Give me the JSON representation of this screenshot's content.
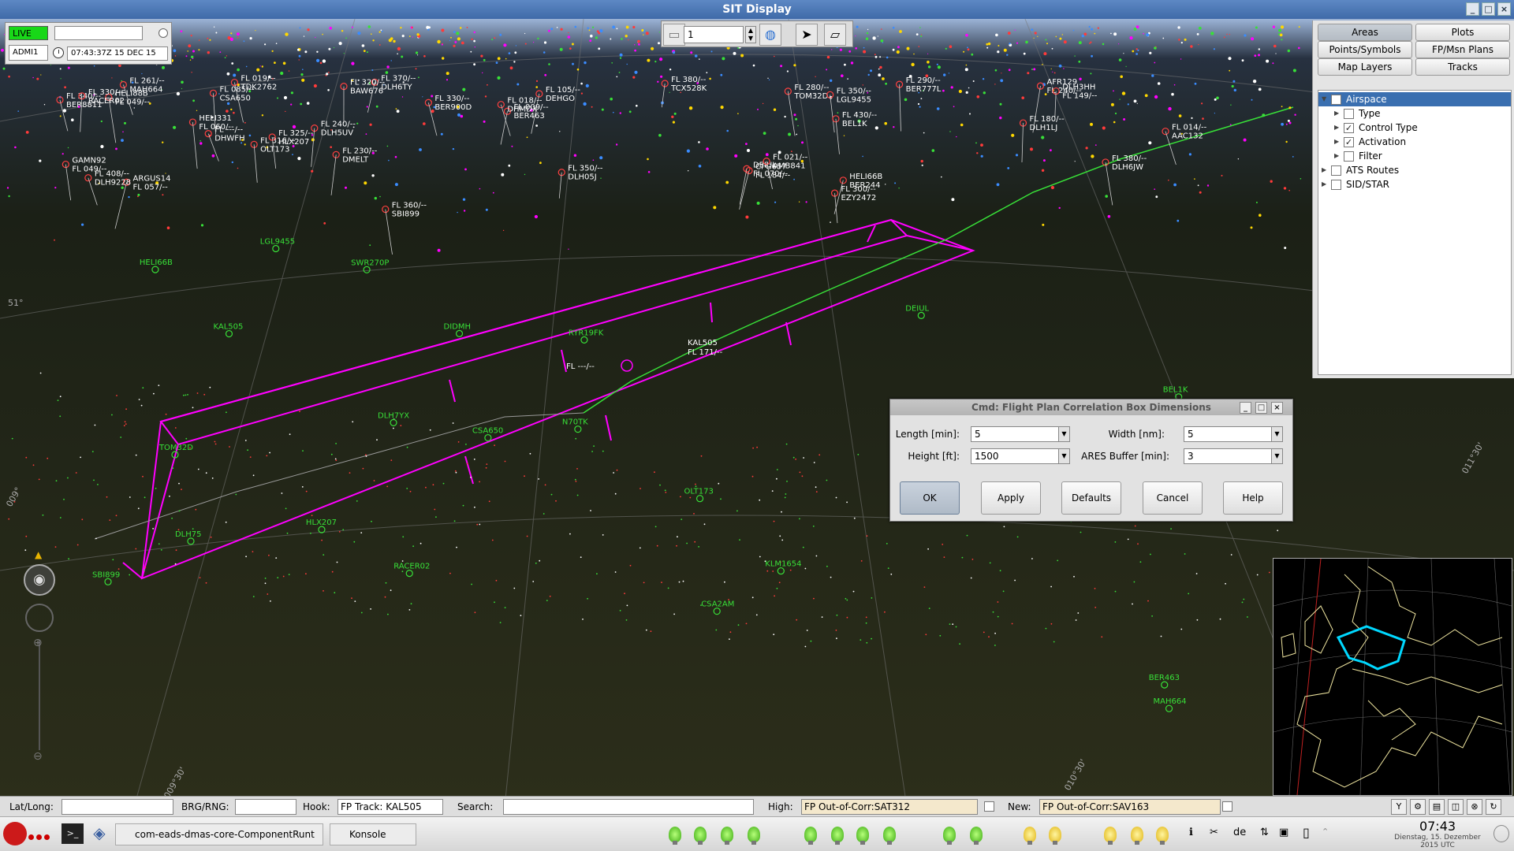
{
  "window": {
    "title": "SIT Display",
    "controls": [
      "_",
      "□",
      "×"
    ]
  },
  "status_panel": {
    "live_label": "LIVE",
    "live_value": "",
    "user": "ADMI1",
    "datetime": "07:43:37Z 15 DEC 15"
  },
  "toolbar": {
    "zoom_value": "1",
    "zoom_up": "▲",
    "zoom_down": "▼",
    "icons": [
      "layers-icon",
      "globe-icon",
      "pointer-icon",
      "ruler-icon"
    ]
  },
  "right_panel": {
    "buttons": [
      {
        "label": "Areas",
        "selected": true
      },
      {
        "label": "Plots",
        "selected": false
      },
      {
        "label": "Points/Symbols",
        "selected": false
      },
      {
        "label": "FP/Msn Plans",
        "selected": false
      },
      {
        "label": "Map Layers",
        "selected": false
      },
      {
        "label": "Tracks",
        "selected": false
      }
    ],
    "tree": [
      {
        "label": "Airspace",
        "level": 0,
        "checked": false,
        "expanded": true,
        "selected": true
      },
      {
        "label": "Type",
        "level": 1,
        "checked": false
      },
      {
        "label": "Control Type",
        "level": 1,
        "checked": true
      },
      {
        "label": "Activation",
        "level": 1,
        "checked": true
      },
      {
        "label": "Filter",
        "level": 1,
        "checked": false
      },
      {
        "label": "ATS Routes",
        "level": 0,
        "checked": false
      },
      {
        "label": "SID/STAR",
        "level": 0,
        "checked": false
      }
    ]
  },
  "dialog": {
    "title": "Cmd: Flight Plan Correlation Box Dimensions",
    "fields": [
      {
        "label": "Length [min]:",
        "value": "5"
      },
      {
        "label": "Width [nm]:",
        "value": "5"
      },
      {
        "label": "Height [ft]:",
        "value": "1500"
      },
      {
        "label": "ARES Buffer [min]:",
        "value": "3"
      }
    ],
    "buttons": [
      "OK",
      "Apply",
      "Defaults",
      "Cancel",
      "Help"
    ]
  },
  "map": {
    "selected_track": {
      "callsign": "KAL505",
      "fl": "FL 171/--"
    },
    "grid_labels": [
      "51°",
      "009°",
      "009°30'",
      "010°30'",
      "011°30'"
    ],
    "tracks": [
      {
        "cs": "FL 340/--"
      },
      {
        "cs": "BER8811"
      },
      {
        "cs": "FL 014/--"
      },
      {
        "cs": "AAC132"
      },
      {
        "cs": "AFR129"
      },
      {
        "cs": "FL 240/--"
      },
      {
        "cs": "ARGUS14"
      },
      {
        "cs": "FL 057/--"
      },
      {
        "cs": "DLH3HH"
      },
      {
        "cs": "FL 149/--"
      },
      {
        "cs": "HELI88B"
      },
      {
        "cs": "FL 049/--"
      },
      {
        "cs": "CFG657"
      },
      {
        "cs": "FL 184/--"
      },
      {
        "cs": "DEIUL"
      },
      {
        "cs": "FL 070/--"
      },
      {
        "cs": "HELI331"
      },
      {
        "cs": "FL 060/--"
      },
      {
        "cs": "HELI66B"
      },
      {
        "cs": "BER244"
      },
      {
        "cs": "FL 230/--"
      },
      {
        "cs": "DMELT"
      },
      {
        "cs": "FL ---/--"
      },
      {
        "cs": "DHWFH"
      },
      {
        "cs": "FL 009/--"
      },
      {
        "cs": "BER463"
      },
      {
        "cs": "FL 380/--"
      },
      {
        "cs": "DLH6JW"
      },
      {
        "cs": "FL 316/--"
      },
      {
        "cs": "OLT173"
      },
      {
        "cs": "FL 180/--"
      },
      {
        "cs": "DLH1LJ"
      },
      {
        "cs": "FL 280/--"
      },
      {
        "cs": "TOM32D"
      },
      {
        "cs": "FL 330/--"
      },
      {
        "cs": "BER900D"
      },
      {
        "cs": "FL 261/--"
      },
      {
        "cs": "MAH664"
      },
      {
        "cs": "FL 380/--"
      },
      {
        "cs": "TCX528K"
      },
      {
        "cs": "FL 350/--"
      },
      {
        "cs": "LGL9455"
      },
      {
        "cs": "FL 325/--"
      },
      {
        "cs": "HLX207"
      },
      {
        "cs": "FL 300/--"
      },
      {
        "cs": "EZY2472"
      },
      {
        "cs": "FL 370/--"
      },
      {
        "cs": "DLH6TY"
      },
      {
        "cs": "FL 360/--"
      },
      {
        "cs": "SBI899"
      },
      {
        "cs": "FL 085/--"
      },
      {
        "cs": "CSA650"
      },
      {
        "cs": "FL 320/--"
      },
      {
        "cs": "BAW676"
      },
      {
        "cs": "FL 350/--"
      },
      {
        "cs": "DLH05J"
      },
      {
        "cs": "FL 330/--"
      },
      {
        "cs": "RACER02"
      },
      {
        "cs": "FL 430/--"
      },
      {
        "cs": "BEL1K"
      },
      {
        "cs": "FL 290/--"
      },
      {
        "cs": "BER777L"
      },
      {
        "cs": "FL 105/--"
      },
      {
        "cs": "DEHGO"
      },
      {
        "cs": "FL 021/--"
      },
      {
        "cs": "AMB841"
      },
      {
        "cs": "FL 240/--"
      },
      {
        "cs": "DLH5UV"
      },
      {
        "cs": "FL 018/--"
      },
      {
        "cs": "DHMDX"
      },
      {
        "cs": "FL 019/--"
      },
      {
        "cs": "TDK2762"
      },
      {
        "cs": "FL 408/--"
      },
      {
        "cs": "DLH9228"
      },
      {
        "cs": "GAMN92"
      },
      {
        "cs": "FL 049/--"
      }
    ],
    "green_tags": [
      "RYR19FK",
      "LGL9455",
      "KAL505",
      "SBI899",
      "HLX207",
      "N70TK",
      "RACER02",
      "CSA650",
      "BEL1K",
      "OLT173",
      "MAH664",
      "EZY2472",
      "DLH75",
      "DLH7YX",
      "BER463",
      "DIDMH",
      "DEIUL",
      "HELI66B",
      "CSA2AM",
      "KLM1654",
      "BAW125",
      "TOM32D",
      "SWR270P"
    ],
    "unknown_track": "FL ---/--"
  },
  "statusbar": {
    "latlong_label": "Lat/Long:",
    "latlong_value": "",
    "brg_label": "BRG/RNG:",
    "brg_value": "",
    "hook_label": "Hook:",
    "hook_value": "FP Track: KAL505",
    "search_label": "Search:",
    "search_value": "",
    "high_label": "High:",
    "high_value": "FP Out-of-Corr:SAT312",
    "new_label": "New:",
    "new_value": "FP Out-of-Corr:SAV163"
  },
  "taskbar": {
    "tasks": [
      "com-eads-dmas-core-ComponentRunt",
      "Konsole"
    ],
    "keyboard": "de",
    "time": "07:43",
    "date": "Dienstag, 15. Dezember 2015 UTC"
  },
  "colors": {
    "area_box": "#ff00ff",
    "route": "#38e038",
    "accent_live": "#18d818",
    "selected_area": "#00d8ff"
  }
}
